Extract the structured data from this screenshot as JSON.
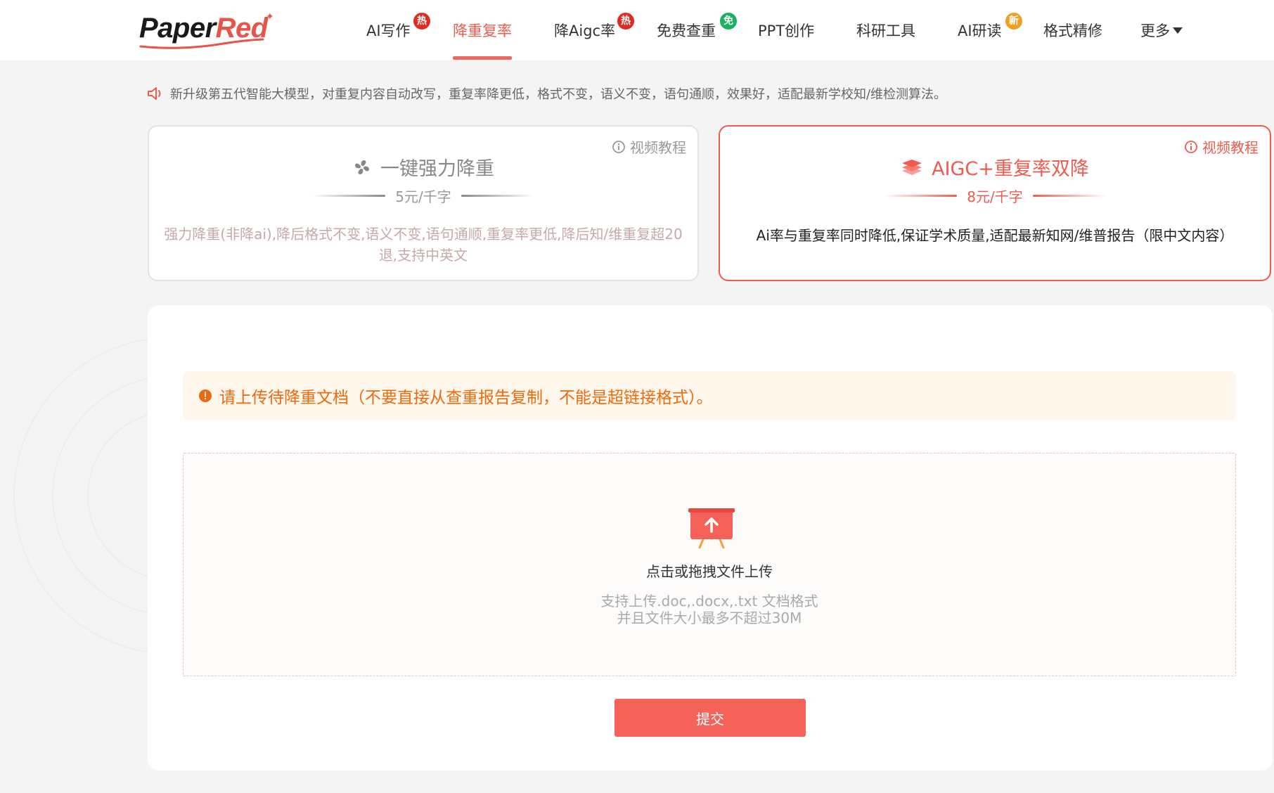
{
  "header": {
    "logo": {
      "part1": "Paper",
      "part2": "Red"
    },
    "nav": [
      {
        "label": "AI写作",
        "badge": "热"
      },
      {
        "label": "降重复率",
        "active": true
      },
      {
        "label": "降Aigc率",
        "badge": "热"
      },
      {
        "label": "免费查重",
        "badge": "免"
      },
      {
        "label": "PPT创作"
      },
      {
        "label": "科研工具"
      },
      {
        "label": "AI研读",
        "badge": "新"
      },
      {
        "label": "格式精修"
      },
      {
        "label": "更多"
      }
    ]
  },
  "notice": {
    "icon": "speaker-icon",
    "text": "新升级第五代智能大模型，对重复内容自动改写，重复率降更低，格式不变，语义不变，语句通顺，效果好，适配最新学校知/维检测算法。"
  },
  "options": [
    {
      "icon": "fan-icon",
      "title": "一键强力降重",
      "price": "5元/千字",
      "tutorial": "视频教程",
      "description": "强力降重(非降ai),降后格式不变,语义不变,语句通顺,重复率更低,降后知/维重复超20退,支持中英文",
      "selected": false
    },
    {
      "icon": "layers-icon",
      "title": "AIGC+重复率双降",
      "price": "8元/千字",
      "tutorial": "视频教程",
      "description": "Ai率与重复率同时降低,保证学术质量,适配最新知网/维普报告（限中文内容）",
      "selected": true
    }
  ],
  "upload": {
    "tip": "请上传待降重文档（不要直接从查重报告复制，不能是超链接格式）。",
    "title": "点击或拖拽文件上传",
    "hint_line1": "支持上传.doc,.docx,.txt 文档格式",
    "hint_line2": "并且文件大小最多不超过30M"
  },
  "submit_label": "提交",
  "colors": {
    "brand": "#ef5b4f",
    "hot_badge": "#e02b20",
    "free_badge": "#17b35c",
    "new_badge": "#f0a020",
    "tip_text": "#ed6a0c",
    "tip_bg": "#fff6ec",
    "button": "#f5625a"
  }
}
